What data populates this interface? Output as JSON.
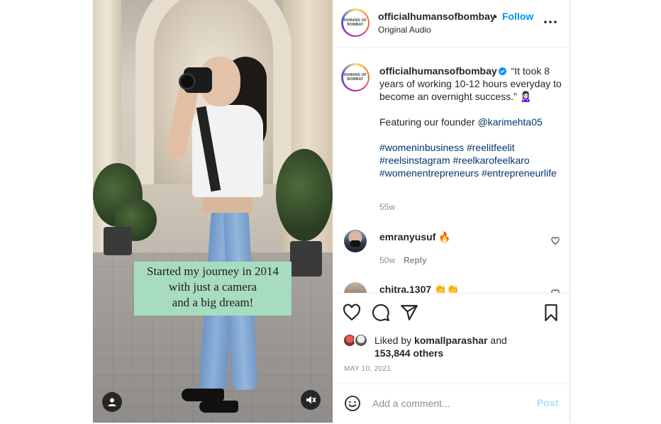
{
  "media": {
    "caption_lines": [
      "Started my journey in 2014",
      "with just a camera",
      "and a big dream!"
    ]
  },
  "header": {
    "avatar_text": [
      "HUMANS OF",
      "BOMBAY"
    ],
    "username": "officialhumansofbombay",
    "separator": "•",
    "follow_label": "Follow",
    "audio_label": "Original Audio"
  },
  "post": {
    "username": "officialhumansofbombay",
    "caption_line1": "“It took 8 years of working 10-12 hours everyday to become an overnight success.” 🙎🏻‍♀️",
    "featuring_prefix": "Featuring our founder ",
    "mention": "@karimehta05",
    "hashtags": [
      "#womeninbusiness",
      "#reelitfeelit",
      "#reelsinstagram",
      "#reelkarofeelkaro",
      "#womenentrepreneurs",
      "#entrepreneurlife"
    ],
    "time": "55w"
  },
  "comments": [
    {
      "username": "emranyusuf",
      "text": "🔥",
      "time": "50w",
      "reply_label": "Reply"
    },
    {
      "username": "chitra.1307",
      "text": "👏👏"
    }
  ],
  "likes": {
    "prefix": "Liked by ",
    "user": "komallparashar",
    "middle": " and",
    "count": "153,844 others",
    "date": "MAY 10, 2021"
  },
  "add_comment": {
    "placeholder": "Add a comment...",
    "post_label": "Post"
  },
  "colors": {
    "accent": "#0095f6",
    "hashtag": "#00376b",
    "caption_box": "#a8dcc0",
    "post_disabled": "#b2dffc"
  }
}
